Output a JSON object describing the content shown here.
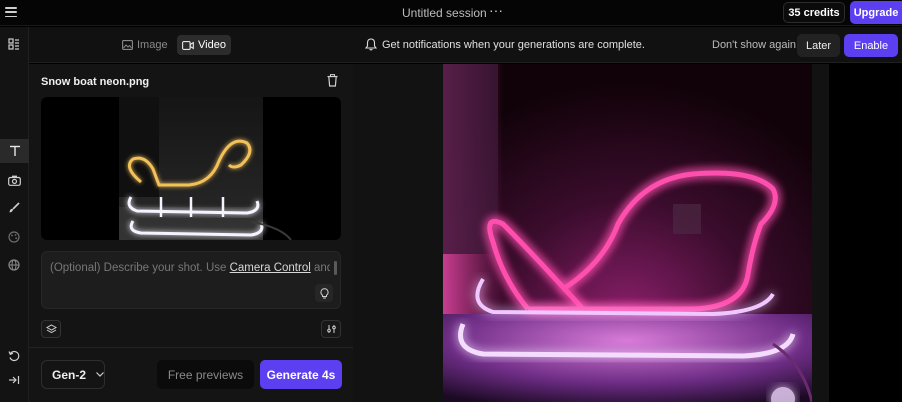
{
  "topbar": {
    "session_title": "Untitled session",
    "more_glyph": "···",
    "credits_label": "35 credits",
    "upgrade_label": "Upgrade"
  },
  "rail": {
    "icons": [
      "text-tool-icon",
      "camera-icon",
      "brush-icon",
      "palette-icon",
      "sphere-icon",
      "history-icon",
      "collapse-icon"
    ]
  },
  "modes": {
    "image_label": "Image",
    "video_label": "Video",
    "active": "Video"
  },
  "editor": {
    "file_name": "Snow boat neon.png",
    "prompt_placeholder_start": "(Optional) Describe your shot. Use ",
    "prompt_link": "Camera Control",
    "prompt_placeholder_end": " and"
  },
  "footer": {
    "model_label": "Gen-2",
    "free_previews_label": "Free previews",
    "generate_label": "Generate 4s"
  },
  "notification": {
    "text": "Get notifications when your generations are complete.",
    "dont_show_label": "Don't show again",
    "later_label": "Later",
    "enable_label": "Enable"
  },
  "colors": {
    "accent": "#5b3ff0",
    "neon_pink": "#ff3ea5",
    "neon_yellow": "#f3c15a"
  }
}
